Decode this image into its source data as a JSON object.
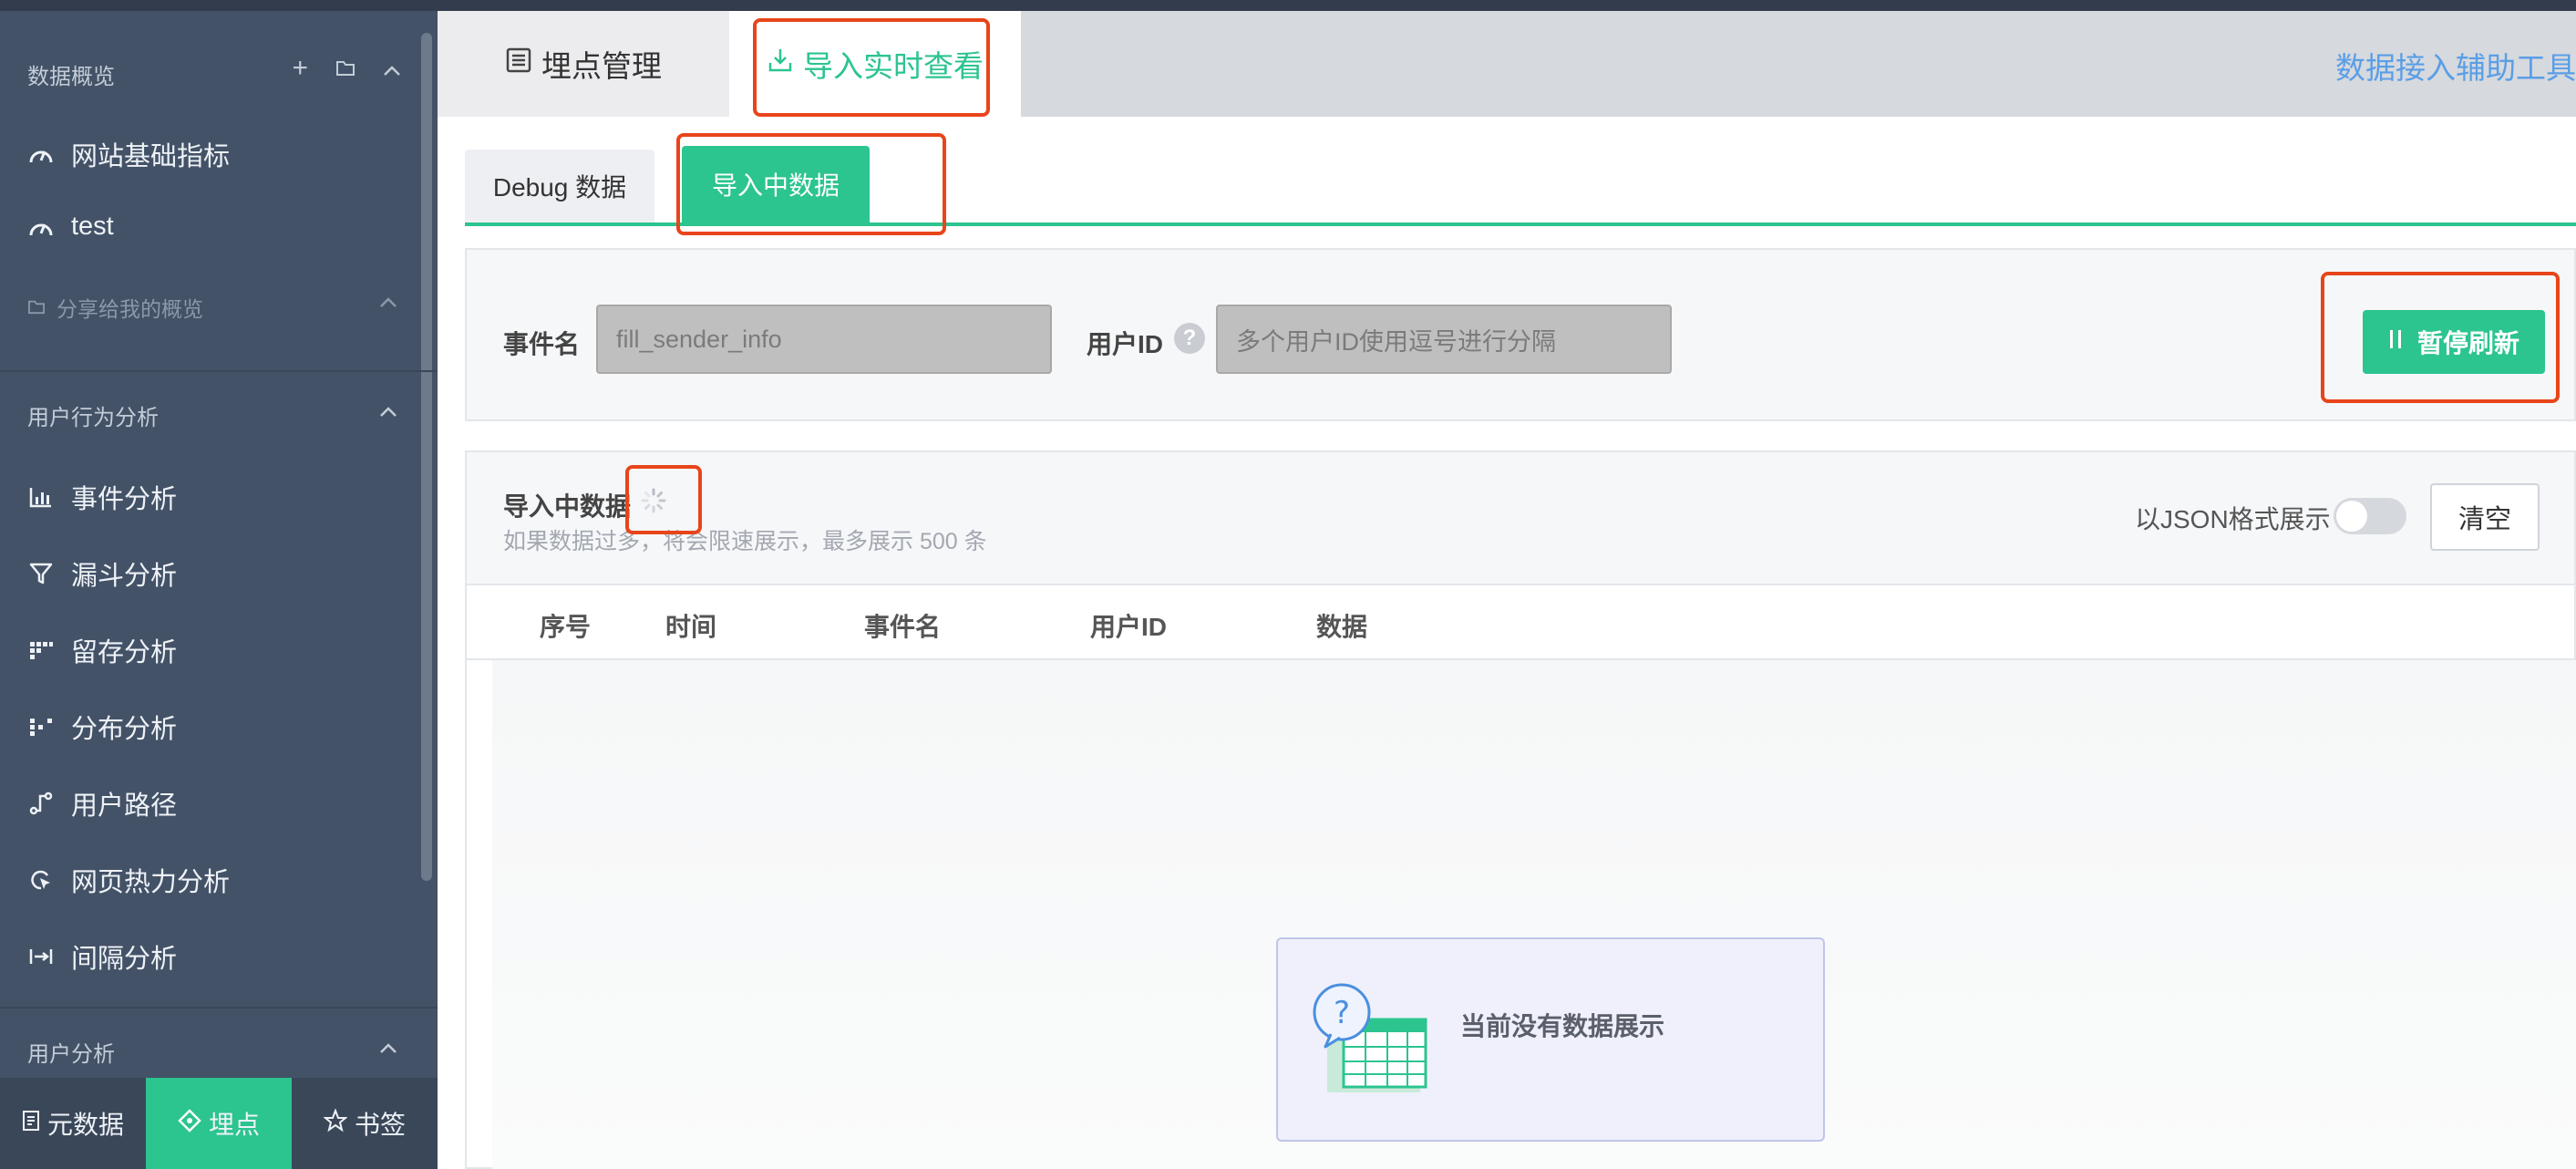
{
  "sidebar": {
    "overview_section": {
      "label": "数据概览"
    },
    "overview_items": [
      {
        "label": "网站基础指标"
      },
      {
        "label": "test"
      }
    ],
    "shared_section": {
      "label": "分享给我的概览"
    },
    "behavior_section": {
      "label": "用户行为分析"
    },
    "behavior_items": [
      {
        "label": "事件分析"
      },
      {
        "label": "漏斗分析"
      },
      {
        "label": "留存分析"
      },
      {
        "label": "分布分析"
      },
      {
        "label": "用户路径"
      },
      {
        "label": "网页热力分析"
      },
      {
        "label": "间隔分析"
      }
    ],
    "user_section": {
      "label": "用户分析"
    },
    "bottom_tabs": [
      {
        "label": "元数据"
      },
      {
        "label": "埋点"
      },
      {
        "label": "书签"
      }
    ]
  },
  "main_tabs": [
    {
      "label": "埋点管理"
    },
    {
      "label": "导入实时查看"
    }
  ],
  "helper_link": "数据接入辅助工具",
  "sub_tabs": [
    {
      "label": "Debug 数据"
    },
    {
      "label": "导入中数据"
    }
  ],
  "filters": {
    "event_label": "事件名",
    "event_placeholder": "fill_sender_info",
    "user_label": "用户ID",
    "user_placeholder": "多个用户ID使用逗号进行分隔",
    "help_glyph": "?",
    "pause_button": "暂停刷新"
  },
  "panel": {
    "title": "导入中数据",
    "subtitle": "如果数据过多，将会限速展示，最多展示 500 条",
    "json_toggle_label": "以JSON格式展示",
    "json_toggle_on": false,
    "clear_button": "清空",
    "columns": [
      "序号",
      "时间",
      "事件名",
      "用户ID",
      "数据"
    ],
    "empty_text": "当前没有数据展示"
  },
  "colors": {
    "accent": "#2cc48f",
    "sidebar_bg": "#435267",
    "highlight": "#e8451a",
    "link": "#5a9ee6"
  }
}
